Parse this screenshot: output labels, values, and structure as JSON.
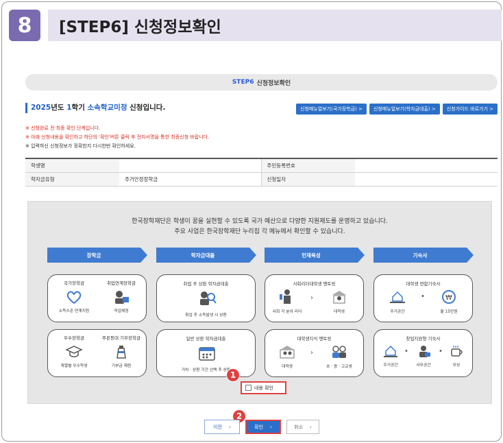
{
  "step": {
    "number": "8",
    "title": "[STEP6] 신청정보확인"
  },
  "header": {
    "step_label": "STEP6",
    "title": "신청정보확인"
  },
  "term": {
    "year": "2025",
    "mid1": "년도 ",
    "semester": "1",
    "mid2": "학기 ",
    "school": "소속학교미정",
    "suffix": " 신청입니다."
  },
  "guide_buttons": [
    "신청매뉴얼보기(국가장학금) >",
    "신청매뉴얼보기(학자금대출) >",
    "신청가이드 바로가기 >"
  ],
  "notes": [
    "※ 신청완료 전 최종 확인 단계입니다.",
    "※ 아래 신청내용을 확인하고 하단의 '확인'버튼 클릭 후 전자서명을 통한 최종신청 바랍니다.",
    "※ 입력하신 신청정보가 정확한지 다시한번 확인하세요."
  ],
  "table": {
    "row1": {
      "label1": "학생명",
      "value1": "",
      "label2": "주민등록번호",
      "value2": ""
    },
    "row2": {
      "label1": "학자금유형",
      "value1": "주거안정장학금",
      "label2": "신청일자",
      "value2": ""
    }
  },
  "intro": {
    "line1": "한국장학재단은 학생이 꿈을 실현할 수 있도록 국가 예산으로 다양한 지원제도를 운영하고 있습니다.",
    "line2": "주요 사업은 한국장학재단 누리집 각 메뉴에서 확인할 수 있습니다."
  },
  "columns": {
    "c1": "장학금",
    "c2": "학자금대출",
    "c3": "인재육성",
    "c4": "기숙사"
  },
  "cards": {
    "a1": {
      "t1": "국가장학금",
      "b1": "소득수준 연계지원",
      "t2": "취업연계장학금",
      "b2": "직업체험"
    },
    "a2": {
      "t1": "우수장학금",
      "b1": "계열별 우수학생",
      "t2": "푸른등대 기부장학금",
      "b2": "기부금 재원"
    },
    "b1": {
      "title": "취업 후 상환 학자금대출",
      "bottom": "취업 후 소득발생 시 상환"
    },
    "b2": {
      "title": "일반 상환 학자금대출",
      "bottom": "거치 · 상환 기간 선택 후 상환"
    },
    "c1": {
      "title": "사회리더대학생 멘토링",
      "b1": "사회 각 분야 리더",
      "b2": "대학생"
    },
    "c2": {
      "title": "대학생지식 멘토링",
      "b1": "대학생",
      "b2": "초 · 중 · 고교생"
    },
    "d1": {
      "title": "대학생 연합기숙사",
      "b1": "주거공간",
      "b2": "월 15만원"
    },
    "d2": {
      "title": "창업지원형 기숙사",
      "b1": "주거공간",
      "b2": "사무공간",
      "b3": "무상"
    }
  },
  "checkbox_label": "내용 확인",
  "markers": {
    "m1": "1",
    "m2": "2"
  },
  "buttons": {
    "prev": "이전",
    "ok": "확인",
    "cancel": "취소"
  },
  "colors": {
    "accent": "#2b6fc8",
    "badge": "#7a6bb0",
    "highlight": "#e0403f"
  }
}
